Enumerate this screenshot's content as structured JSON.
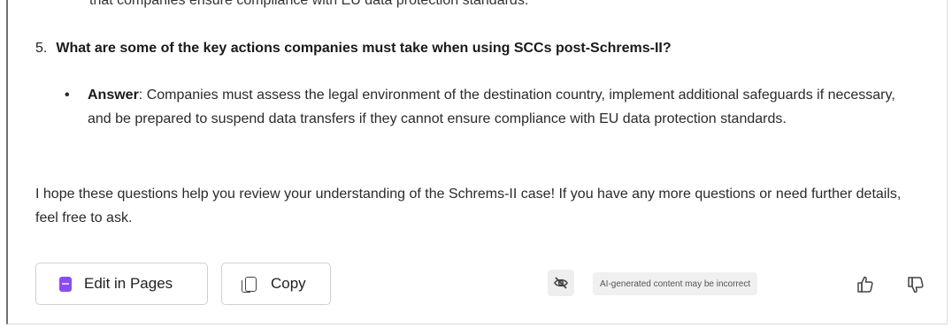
{
  "message": {
    "cut_line": "that companies ensure compliance with EU data protection standards.",
    "question": {
      "number": "5.",
      "text": "What are some of the key actions companies must take when using SCCs post-Schrems-II?"
    },
    "answer": {
      "bullet": "•",
      "label": "Answer",
      "text": ": Companies must assess the legal environment of the destination country, implement additional safeguards if necessary, and be prepared to suspend data transfers if they cannot ensure compliance with EU data protection standards."
    },
    "closing": "I hope these questions help you review your understanding of the Schrems-II case! If you have any more questions or need further details, feel free to ask."
  },
  "actions": {
    "edit_in_pages_label": "Edit in Pages",
    "copy_label": "Copy",
    "ai_disclaimer": "AI-generated content may be incorrect",
    "icons": {
      "pages": "pages-icon",
      "copy": "copy-icon",
      "visibility": "eye-slash-icon",
      "like": "thumbs-up-icon",
      "dislike": "thumbs-down-icon"
    },
    "colors": {
      "pages_accent": "#8a4cf0"
    }
  }
}
